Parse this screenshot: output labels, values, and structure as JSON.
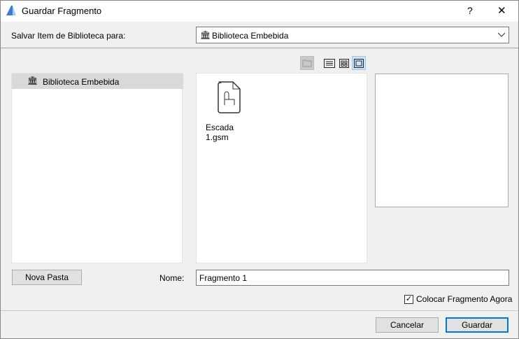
{
  "window": {
    "title": "Guardar Fragmento",
    "help": "?",
    "close": "✕"
  },
  "save_to": {
    "label": "Salvar Item de Biblioteca para:",
    "value": "Biblioteca Embebida"
  },
  "tree": {
    "items": [
      {
        "label": "Biblioteca Embebida",
        "selected": true
      }
    ]
  },
  "files": [
    {
      "name": "Escada 1.gsm"
    }
  ],
  "name_field": {
    "label": "Nome:",
    "value": "Fragmento 1"
  },
  "new_folder": "Nova Pasta",
  "place_now": {
    "label": "Colocar Fragmento Agora",
    "checked": true
  },
  "buttons": {
    "cancel": "Cancelar",
    "save": "Guardar"
  }
}
